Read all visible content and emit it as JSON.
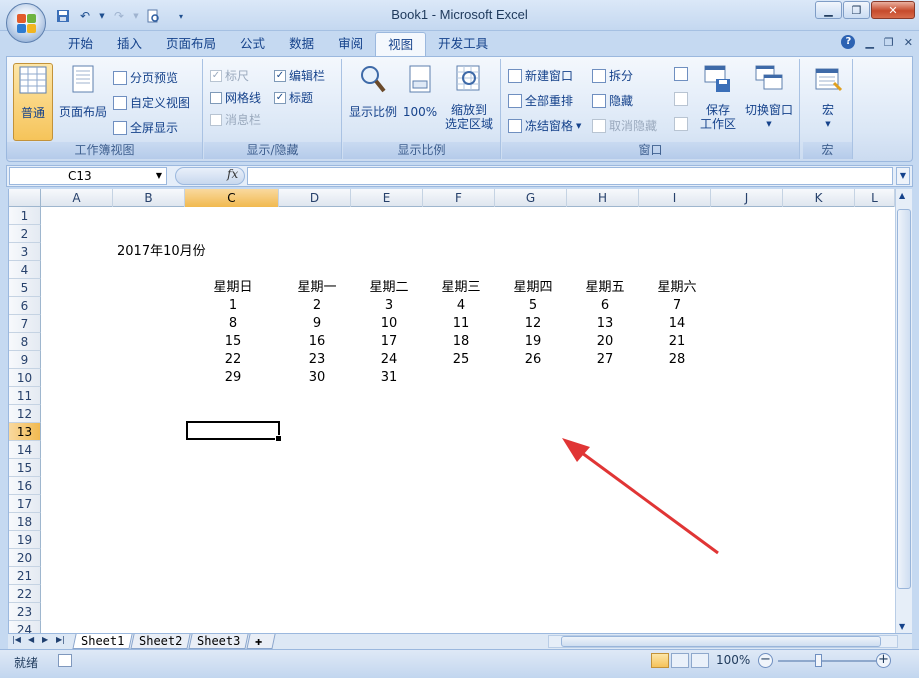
{
  "window": {
    "title": "Book1 - Microsoft Excel"
  },
  "tabs": [
    "开始",
    "插入",
    "页面布局",
    "公式",
    "数据",
    "审阅",
    "视图",
    "开发工具"
  ],
  "active_tab": "视图",
  "ribbon": {
    "workbook_views": {
      "label": "工作簿视图",
      "normal": "普通",
      "page_layout": "页面布局",
      "page_break": "分页预览",
      "custom_views": "自定义视图",
      "full_screen": "全屏显示"
    },
    "show_hide": {
      "label": "显示/隐藏",
      "ruler": "标尺",
      "gridlines": "网格线",
      "message_bar": "消息栏",
      "formula_bar": "编辑栏",
      "headings": "标题"
    },
    "zoom": {
      "label": "显示比例",
      "zoom": "显示比例",
      "zoom100": "100%",
      "zoom_sel_1": "缩放到",
      "zoom_sel_2": "选定区域"
    },
    "window": {
      "label": "窗口",
      "new_window": "新建窗口",
      "arrange_all": "全部重排",
      "freeze": "冻结窗格",
      "split": "拆分",
      "hide": "隐藏",
      "unhide": "取消隐藏",
      "save_ws_1": "保存",
      "save_ws_2": "工作区",
      "switch": "切换窗口"
    },
    "macros": {
      "label": "宏",
      "macros": "宏"
    }
  },
  "formula_bar": {
    "name_box": "C13",
    "fx": "fx",
    "value": ""
  },
  "columns": [
    "A",
    "B",
    "C",
    "D",
    "E",
    "F",
    "G",
    "H",
    "I",
    "J",
    "K",
    "L"
  ],
  "selected_column": "C",
  "rows": [
    "1",
    "2",
    "3",
    "4",
    "5",
    "6",
    "7",
    "8",
    "9",
    "10",
    "11",
    "12",
    "13",
    "14",
    "15",
    "16",
    "17",
    "18",
    "19",
    "20",
    "21",
    "22",
    "23",
    "24"
  ],
  "selected_row": "13",
  "sheet": {
    "title": "2017年10月份",
    "weekdays": [
      "星期日",
      "星期一",
      "星期二",
      "星期三",
      "星期四",
      "星期五",
      "星期六"
    ],
    "weeks": [
      [
        "1",
        "2",
        "3",
        "4",
        "5",
        "6",
        "7"
      ],
      [
        "8",
        "9",
        "10",
        "11",
        "12",
        "13",
        "14"
      ],
      [
        "15",
        "16",
        "17",
        "18",
        "19",
        "20",
        "21"
      ],
      [
        "22",
        "23",
        "24",
        "25",
        "26",
        "27",
        "28"
      ],
      [
        "29",
        "30",
        "31",
        "",
        "",
        "",
        ""
      ]
    ]
  },
  "sheet_tabs": [
    "Sheet1",
    "Sheet2",
    "Sheet3"
  ],
  "active_sheet": "Sheet1",
  "status": {
    "ready": "就绪",
    "zoom": "100%"
  }
}
